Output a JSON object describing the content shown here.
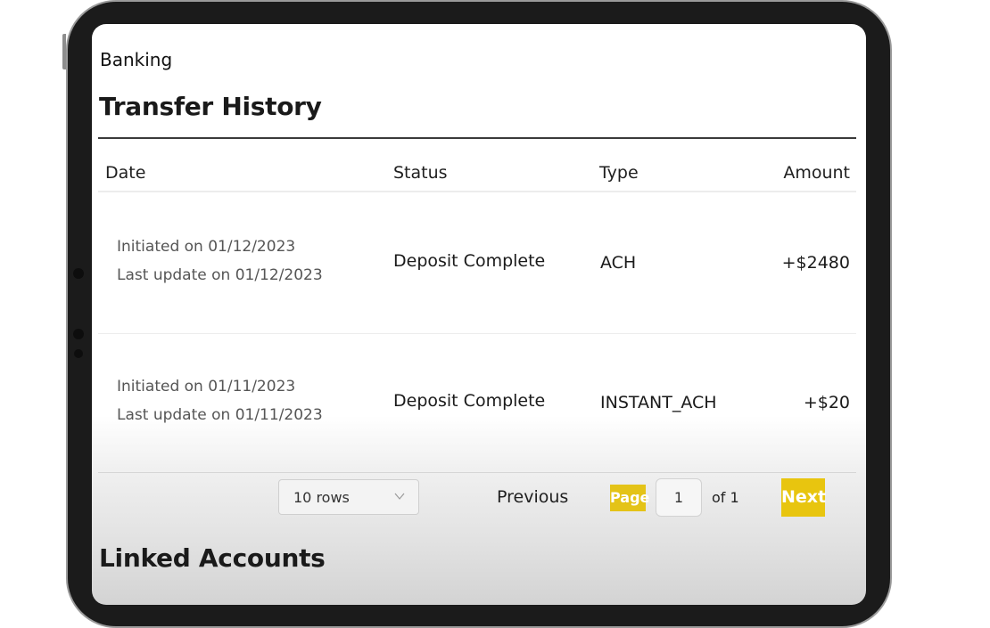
{
  "breadcrumb": "Banking",
  "transfer_history": {
    "title": "Transfer History",
    "columns": {
      "date": "Date",
      "status": "Status",
      "type": "Type",
      "amount": "Amount"
    },
    "rows": [
      {
        "initiated": "Initiated on 01/12/2023",
        "updated": "Last update on 01/12/2023",
        "status": "Deposit Complete",
        "type": "ACH",
        "amount": "+$2480"
      },
      {
        "initiated": "Initiated on 01/11/2023",
        "updated": "Last update on 01/11/2023",
        "status": "Deposit Complete",
        "type": "INSTANT_ACH",
        "amount": "+$20"
      }
    ]
  },
  "pagination": {
    "rows_selected": "10 rows",
    "previous_label": "Previous",
    "page_label": "Page",
    "current_page": "1",
    "of_label": "of 1",
    "next_label": "Next"
  },
  "linked_accounts": {
    "title": "Linked Accounts"
  },
  "colors": {
    "accent": "#e8c50f",
    "text": "#1a1a1a",
    "muted_text": "#555555",
    "device_frame": "#1b1b1b"
  }
}
